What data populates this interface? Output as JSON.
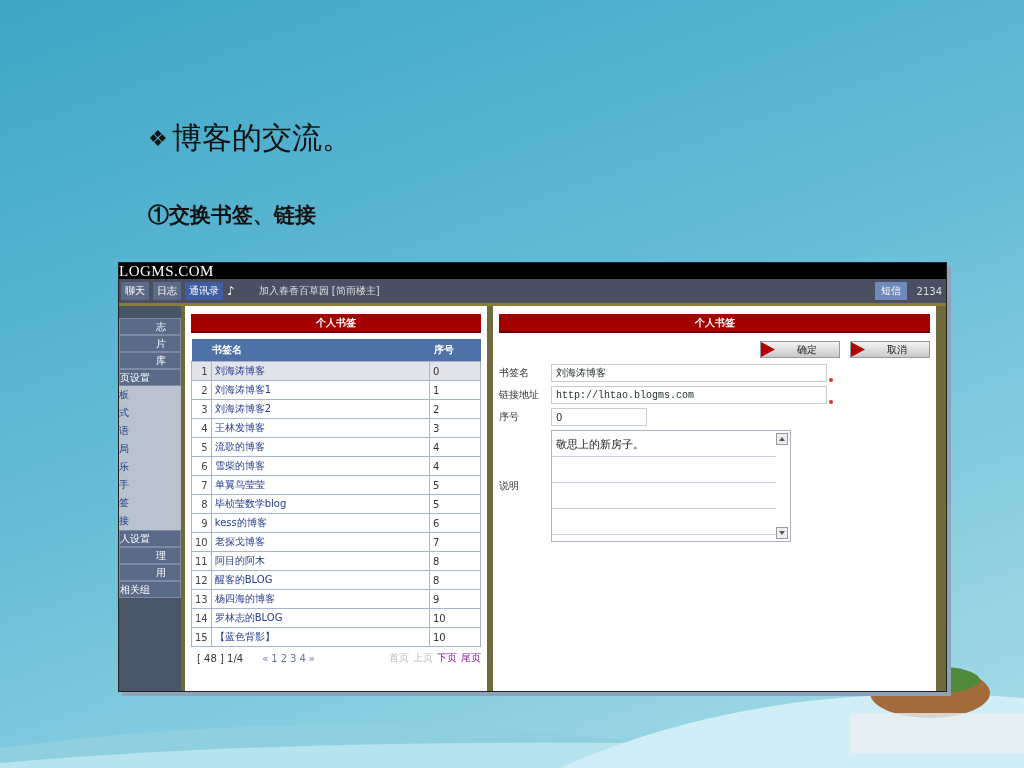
{
  "slide": {
    "bullet": "❖",
    "title": "博客的交流。",
    "subtitle": "①交换书签、链接"
  },
  "site": {
    "logo": "LOGMS.COM",
    "tabs": [
      {
        "label": "聊天",
        "selected": false
      },
      {
        "label": "日志",
        "selected": false
      },
      {
        "label": "通讯录",
        "selected": true
      }
    ],
    "music": "♪",
    "notice": "加入春香百草园 [简雨楼主]",
    "sms_button": "短信",
    "sms_count": "2134"
  },
  "sidebar": {
    "items": [
      {
        "label": "志",
        "kind": "tab"
      },
      {
        "label": "片",
        "kind": "tab"
      },
      {
        "label": "库",
        "kind": "tab"
      },
      {
        "label": "页设置",
        "kind": "tab"
      },
      {
        "label": "板",
        "kind": "link"
      },
      {
        "label": "式",
        "kind": "link"
      },
      {
        "label": "语",
        "kind": "link"
      },
      {
        "label": "局",
        "kind": "link"
      },
      {
        "label": "乐",
        "kind": "link"
      },
      {
        "label": "手",
        "kind": "link"
      },
      {
        "label": "签",
        "kind": "link"
      },
      {
        "label": "接",
        "kind": "link"
      },
      {
        "label": "人设置",
        "kind": "tab"
      },
      {
        "label": "理",
        "kind": "tab"
      },
      {
        "label": "用",
        "kind": "tab"
      },
      {
        "label": "相关组",
        "kind": "tab"
      }
    ]
  },
  "bookmark_list": {
    "title": "个人书签",
    "columns": [
      "书签名",
      "序号"
    ],
    "rows": [
      {
        "index": "1",
        "name": "刘海涛博客",
        "order": "0",
        "selected": true
      },
      {
        "index": "2",
        "name": "刘海涛博客1",
        "order": "1",
        "selected": false
      },
      {
        "index": "3",
        "name": "刘海涛博客2",
        "order": "2",
        "selected": false
      },
      {
        "index": "4",
        "name": "王林发博客",
        "order": "3",
        "selected": false
      },
      {
        "index": "5",
        "name": "流歌的博客",
        "order": "4",
        "selected": false
      },
      {
        "index": "6",
        "name": "雪柴的博客",
        "order": "4",
        "selected": false
      },
      {
        "index": "7",
        "name": "单翼鸟莹莹",
        "order": "5",
        "selected": false
      },
      {
        "index": "8",
        "name": "毕桢莹数学blog",
        "order": "5",
        "selected": false
      },
      {
        "index": "9",
        "name": "kess的博客",
        "order": "6",
        "selected": false
      },
      {
        "index": "10",
        "name": "老探戈博客",
        "order": "7",
        "selected": false
      },
      {
        "index": "11",
        "name": "阿目的阿木",
        "order": "8",
        "selected": false
      },
      {
        "index": "12",
        "name": "醒客的BLOG",
        "order": "8",
        "selected": false
      },
      {
        "index": "13",
        "name": "杨四海的博客",
        "order": "9",
        "selected": false
      },
      {
        "index": "14",
        "name": "罗林志的BLOG",
        "order": "10",
        "selected": false
      },
      {
        "index": "15",
        "name": "【蓝色背影】",
        "order": "10",
        "selected": false
      }
    ],
    "pager": {
      "summary": "[ 48 ] 1/4",
      "first": "«",
      "pages": [
        "1",
        "2",
        "3",
        "4"
      ],
      "last": "»",
      "links": [
        {
          "label": "首页",
          "disabled": true
        },
        {
          "label": "上页",
          "disabled": true
        },
        {
          "label": "下页",
          "disabled": false
        },
        {
          "label": "尾页",
          "disabled": false
        }
      ]
    }
  },
  "bookmark_form": {
    "title": "个人书签",
    "buttons": [
      "确定",
      "取消"
    ],
    "fields": [
      {
        "label": "书签名",
        "kind": "text",
        "value": "刘海涛博客",
        "required": true
      },
      {
        "label": "链接地址",
        "kind": "url",
        "value": "http://lhtao.blogms.com",
        "required": true
      },
      {
        "label": "序号",
        "kind": "short",
        "value": "0",
        "required": false
      },
      {
        "label": "说明",
        "kind": "textarea",
        "value": "敬思上的新房子。",
        "required": false
      }
    ]
  }
}
